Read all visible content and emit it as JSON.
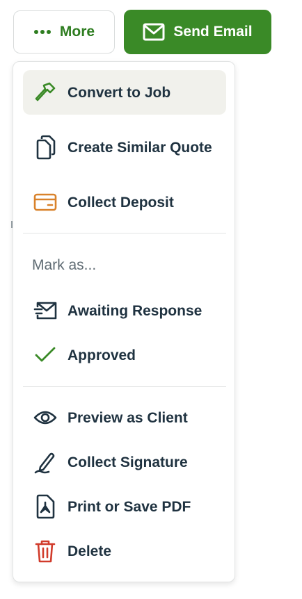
{
  "toolbar": {
    "more_label": "More",
    "send_email_label": "Send Email"
  },
  "menu": {
    "items": [
      {
        "label": "Convert to Job",
        "icon": "hammer-icon"
      },
      {
        "label": "Create Similar Quote",
        "icon": "copy-document-icon"
      },
      {
        "label": "Collect Deposit",
        "icon": "credit-card-icon"
      }
    ],
    "mark_as_label": "Mark as...",
    "mark_items": [
      {
        "label": "Awaiting Response",
        "icon": "envelope-arrow-icon"
      },
      {
        "label": "Approved",
        "icon": "checkmark-icon"
      }
    ],
    "action_items": [
      {
        "label": "Preview as Client",
        "icon": "eye-icon"
      },
      {
        "label": "Collect Signature",
        "icon": "pen-signature-icon"
      },
      {
        "label": "Print or Save PDF",
        "icon": "pdf-document-icon"
      },
      {
        "label": "Delete",
        "icon": "trash-icon"
      }
    ]
  },
  "colors": {
    "brand_green": "#3a8a27",
    "text_dark": "#1f3240",
    "deposit_orange": "#d9822b",
    "delete_red": "#d13b2b",
    "active_bg": "#f1f1ec"
  }
}
